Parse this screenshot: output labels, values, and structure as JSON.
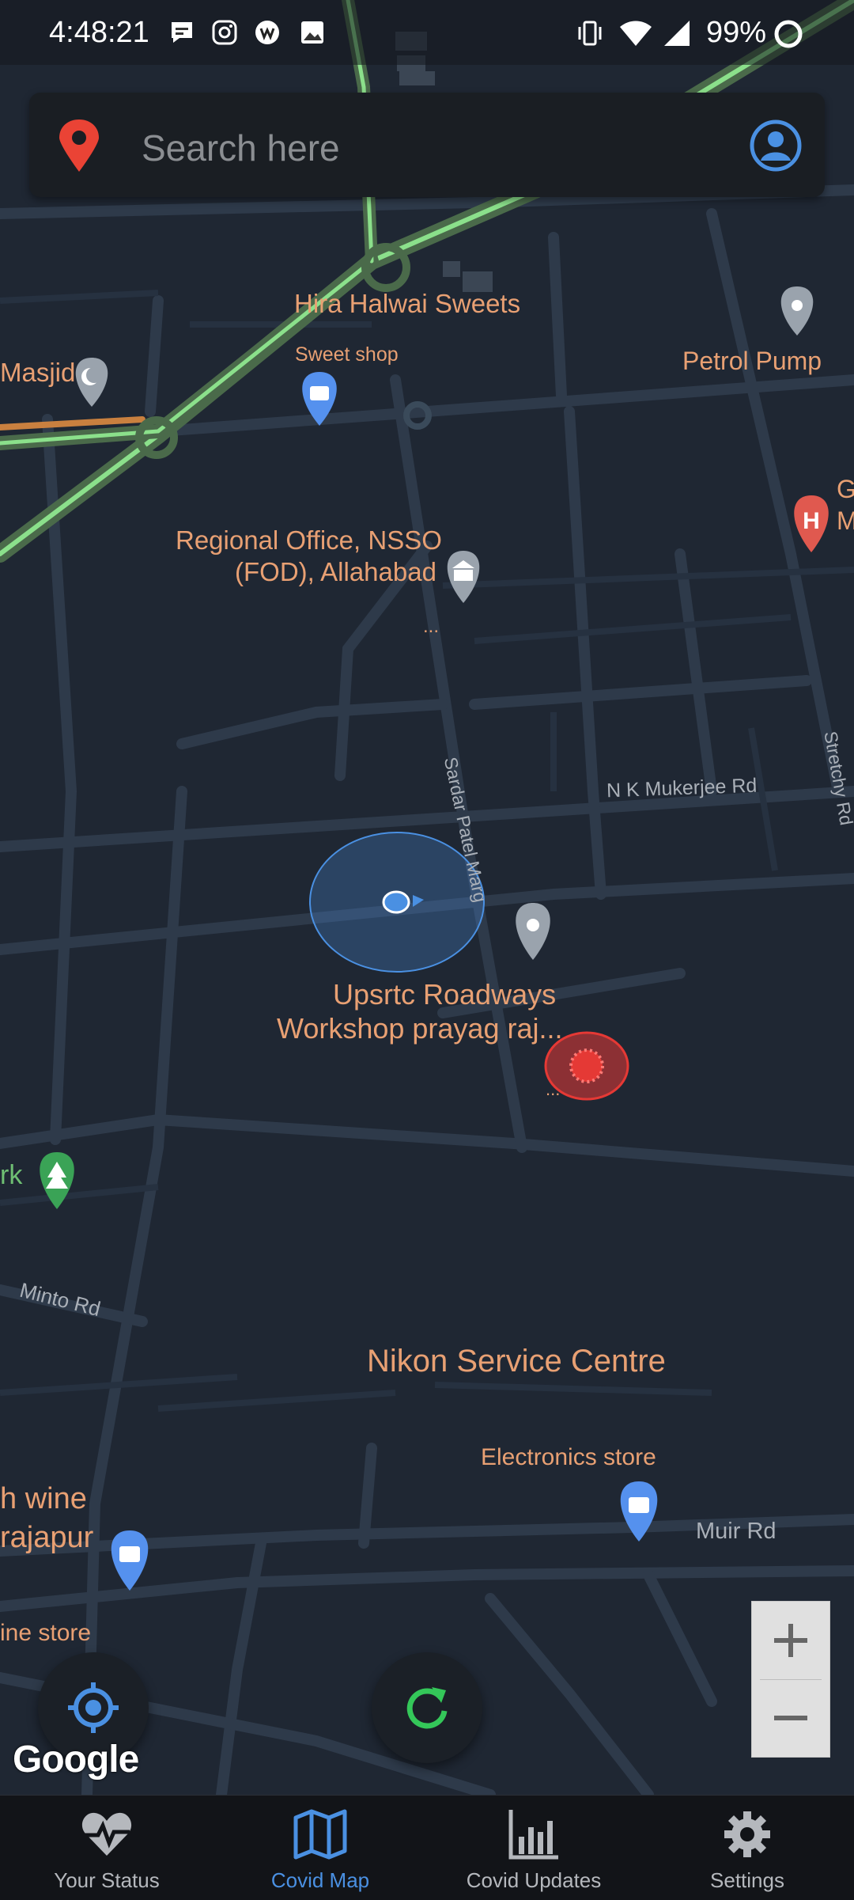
{
  "status_bar": {
    "time": "4:48:21",
    "battery": "99%"
  },
  "search": {
    "placeholder": "Search here"
  },
  "map": {
    "places": {
      "hira": "Hira Halwai Sweets",
      "sweet_shop": "Sweet shop",
      "masjid": "Masjid",
      "petrol": "Petrol Pump",
      "hospital_partial_1": "G",
      "hospital_partial_2": "M",
      "nsso_line1": "Regional Office, NSSO",
      "nsso_line2": "(FOD), Allahabad",
      "ellipsis": "...",
      "upsrtc_line1": "Upsrtc Roadways",
      "upsrtc_line2": "Workshop prayag raj...",
      "park_partial": "rk",
      "nikon": "Nikon Service Centre",
      "electronics": "Electronics store",
      "wine_line1": "h wine",
      "wine_line2": "rajapur",
      "wine_store": "ine store"
    },
    "roads": {
      "sardar": "Sardar Patel Marg",
      "nk": "N K Mukerjee Rd",
      "stretchy": "Stretchy Rd",
      "minto": "Minto Rd",
      "muir": "Muir Rd"
    },
    "attribution": "Google"
  },
  "zoom": {
    "in": "+",
    "out": "−"
  },
  "nav": {
    "items": [
      {
        "label": "Your Status",
        "icon": "heartbeat-icon"
      },
      {
        "label": "Covid Map",
        "icon": "map-icon"
      },
      {
        "label": "Covid Updates",
        "icon": "bar-chart-icon"
      },
      {
        "label": "Settings",
        "icon": "gear-icon"
      }
    ],
    "active": "Covid Map"
  },
  "colors": {
    "accent": "#4a90e2",
    "map_bg": "#1f2733",
    "label": "#e8a073",
    "refresh": "#34c759",
    "covid_marker": "#e53935"
  }
}
